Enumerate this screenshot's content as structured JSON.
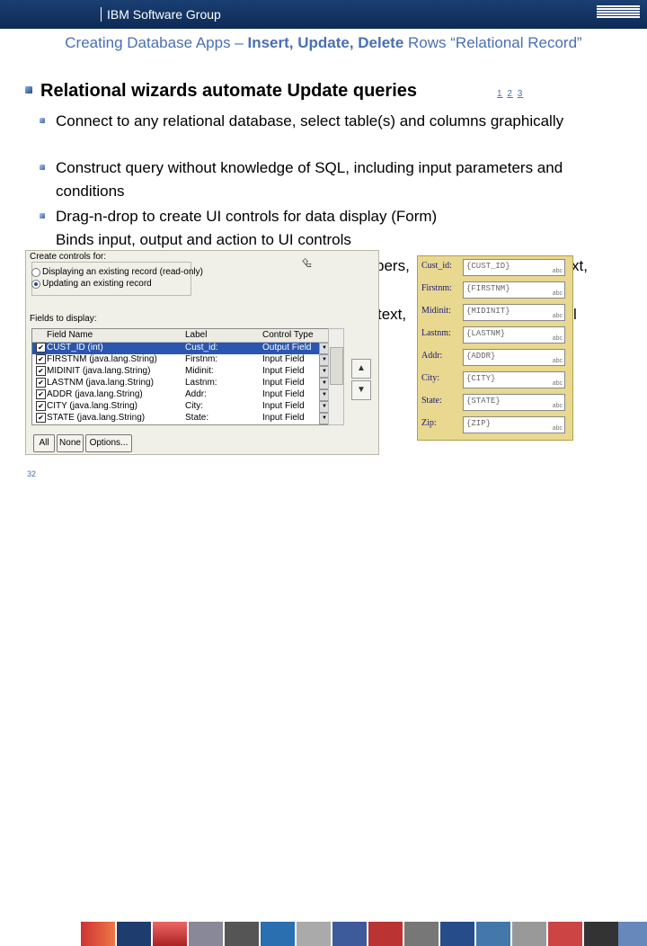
{
  "header": {
    "group": "IBM Software Group",
    "logo": "ibm-logo"
  },
  "title": {
    "plain": "Creating Database Apps – ",
    "bold": "Insert, Update, Delete",
    "rest": " Rows “Relational Record”"
  },
  "main": {
    "heading": "Relational wizards automate Update queries",
    "refs": [
      "1",
      "2",
      "3"
    ],
    "bullets": [
      "Connect to any relational database, select table(s) and columns graphically",
      "Construct query without knowledge of SQL, including input parameters and conditions",
      "Drag-n-drop to create UI controls for data display (Form)",
      "Binds input, output and action to UI controls"
    ],
    "partial_1": "bers,",
    "partial_2": "xt,",
    "partial_3": "text,",
    "partial_4": "l"
  },
  "dialog": {
    "controls_label": "Create controls for:",
    "radio_display": "Displaying an existing record (read-only)",
    "radio_update": "Updating an existing record",
    "fields_label": "Fields to display:",
    "columns": [
      "Field Name",
      "Label",
      "Control Type"
    ],
    "rows": [
      {
        "field": "CUST_ID (int)",
        "label": "Cust_id:",
        "type": "Output Field",
        "selected": true
      },
      {
        "field": "FIRSTNM (java.lang.String)",
        "label": "Firstnm:",
        "type": "Input Field",
        "selected": false
      },
      {
        "field": "MIDINIT (java.lang.String)",
        "label": "Midinit:",
        "type": "Input Field",
        "selected": false
      },
      {
        "field": "LASTNM (java.lang.String)",
        "label": "Lastnm:",
        "type": "Input Field",
        "selected": false
      },
      {
        "field": "ADDR (java.lang.String)",
        "label": "Addr:",
        "type": "Input Field",
        "selected": false
      },
      {
        "field": "CITY (java.lang.String)",
        "label": "City:",
        "type": "Input Field",
        "selected": false
      },
      {
        "field": "STATE (java.lang.String)",
        "label": "State:",
        "type": "Input Field",
        "selected": false
      }
    ],
    "buttons": {
      "all": "All",
      "none": "None",
      "options": "Options..."
    },
    "side_icons": [
      "move-up-icon",
      "move-down-icon"
    ]
  },
  "form": {
    "rows": [
      {
        "label": "Cust_id:",
        "value": "{CUST_ID}"
      },
      {
        "label": "Firstnm:",
        "value": "{FIRSTNM}"
      },
      {
        "label": "Midinit:",
        "value": "{MIDINIT}"
      },
      {
        "label": "Lastnm:",
        "value": "{LASTNM}"
      },
      {
        "label": "Addr:",
        "value": "{ADDR}"
      },
      {
        "label": "City:",
        "value": "{CITY}"
      },
      {
        "label": "State:",
        "value": "{STATE}"
      },
      {
        "label": "Zip:",
        "value": "{ZIP}"
      }
    ],
    "abc": "abc"
  },
  "footer": {
    "page": "32"
  },
  "colors": {
    "header_bg": "#1a3f73",
    "title": "#4a6fb3",
    "form_bg": "#e8d890",
    "selection": "#2a55b0"
  }
}
